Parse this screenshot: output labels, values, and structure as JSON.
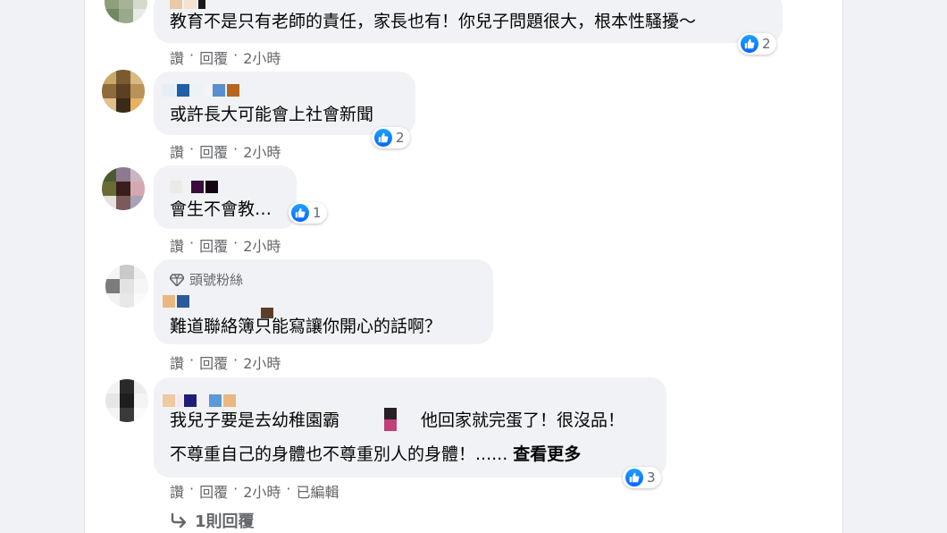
{
  "comments": [
    {
      "text": "教育不是只有老師的責任，家長也有！你兒子問題很大，根本性騷擾～",
      "reactions": "2",
      "actions": {
        "like": "讚",
        "reply": "回覆",
        "time": "2小時"
      }
    },
    {
      "text": "或許長大可能會上社會新聞",
      "reactions": "2",
      "actions": {
        "like": "讚",
        "reply": "回覆",
        "time": "2小時"
      }
    },
    {
      "text": "會生不會教…",
      "reactions": "1",
      "actions": {
        "like": "讚",
        "reply": "回覆",
        "time": "2小時"
      }
    },
    {
      "badge": "頭號粉絲",
      "text": "難道聯絡簿只能寫讓你開心的話啊？",
      "actions": {
        "like": "讚",
        "reply": "回覆",
        "time": "2小時"
      }
    },
    {
      "text_line1_a": "我兒子要是去幼稚園霸",
      "text_line1_b": "他回家就完蛋了！很沒品！",
      "text_line2": "不尊重自己的身體也不尊重別人的身體！......",
      "see_more": "查看更多",
      "reactions": "3",
      "actions": {
        "like": "讚",
        "reply": "回覆",
        "time": "2小時",
        "edited": "已編輯"
      }
    }
  ],
  "replies_link": "1則回覆",
  "colors": {
    "like_blue": "#0866ff",
    "bubble": "#f0f2f5",
    "meta": "#65676b"
  }
}
